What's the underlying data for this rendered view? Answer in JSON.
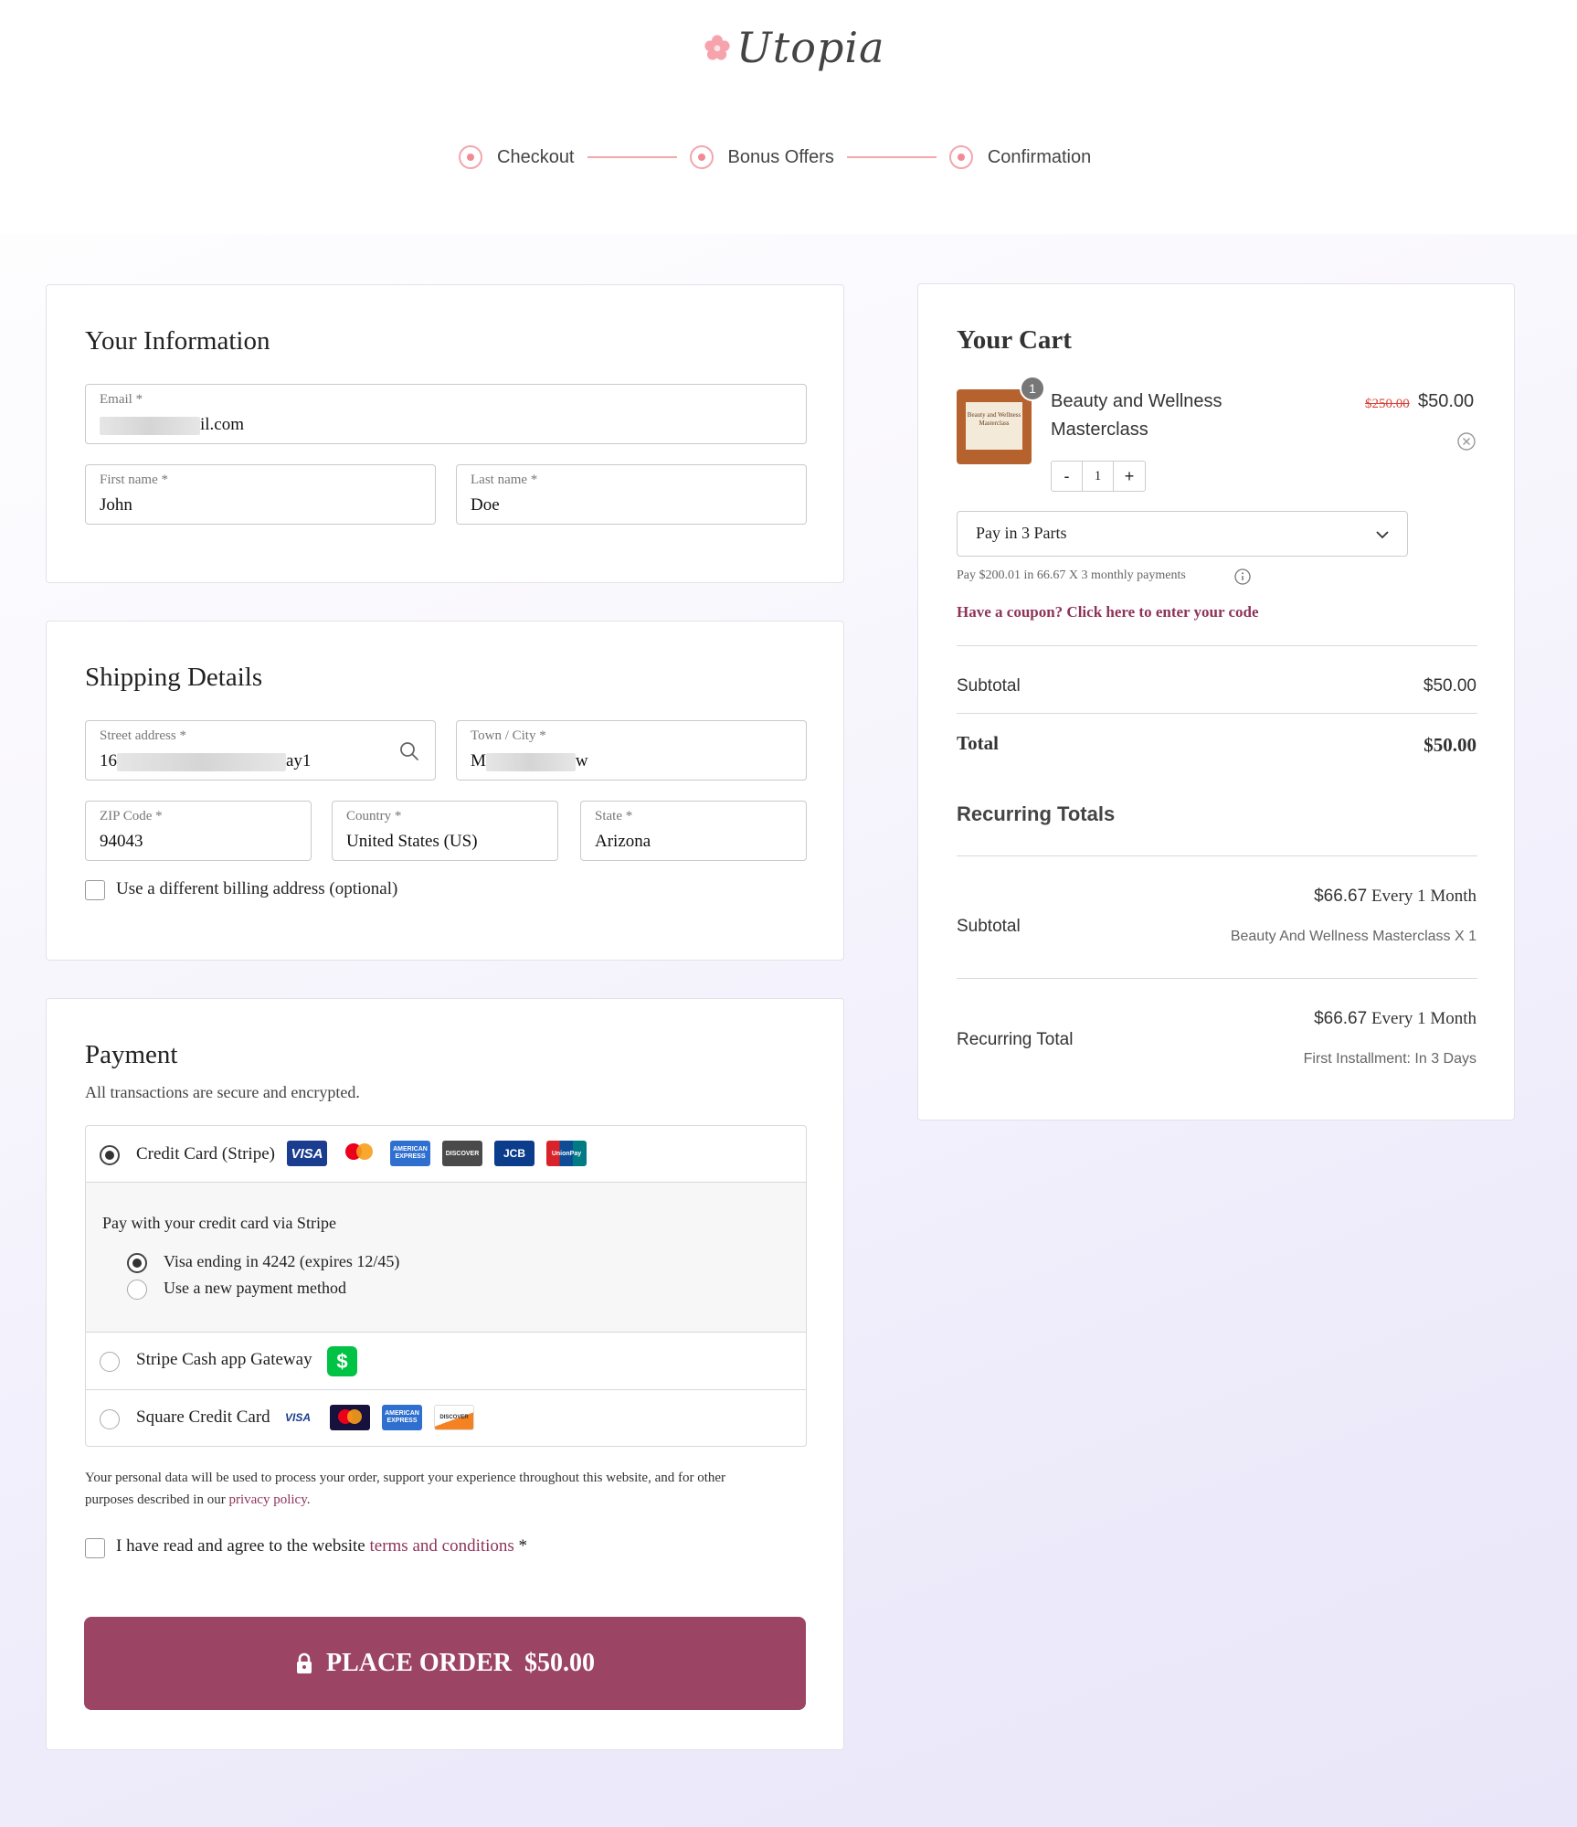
{
  "brand": {
    "name": "Utopia"
  },
  "steps": [
    {
      "label": "Checkout"
    },
    {
      "label": "Bonus Offers"
    },
    {
      "label": "Confirmation"
    }
  ],
  "info": {
    "title": "Your Information",
    "email_label": "Email *",
    "email_suffix": "il.com",
    "first_name_label": "First name *",
    "first_name": "John",
    "last_name_label": "Last name *",
    "last_name": "Doe"
  },
  "shipping": {
    "title": "Shipping Details",
    "street_label": "Street address *",
    "street_prefix": "16",
    "street_suffix": "ay1",
    "city_label": "Town / City *",
    "city_prefix": "M",
    "city_suffix": "w",
    "zip_label": "ZIP Code *",
    "zip": "94043",
    "country_label": "Country *",
    "country": "United States (US)",
    "state_label": "State *",
    "state": "Arizona",
    "billing_checkbox_label": "Use a different billing address (optional)"
  },
  "payment": {
    "title": "Payment",
    "subtitle": "All transactions are secure and encrypted.",
    "methods": [
      {
        "label": "Credit Card (Stripe)"
      },
      {
        "label": "Stripe Cash app Gateway"
      },
      {
        "label": "Square Credit Card"
      }
    ],
    "card_logos": [
      "VISA",
      "mastercard",
      "AMERICAN EXPRESS",
      "DISCOVER",
      "JCB",
      "UnionPay"
    ],
    "square_logos": [
      "VISA",
      "mastercard",
      "AMERICAN EXPRESS",
      "DISCOVER"
    ],
    "stripe_intro": "Pay with your credit card via Stripe",
    "saved_card": "Visa ending in 4242 (expires 12/45)",
    "new_method": "Use a new payment method",
    "privacy_text": "Your personal data will be used to process your order, support your experience throughout this website, and for other",
    "privacy_text2": "purposes described in our",
    "privacy_link": "privacy policy",
    "privacy_end": ".",
    "terms_prefix": "I have read and agree to the website",
    "terms_link": "terms and conditions",
    "terms_suffix": "*",
    "place_order_label": "PLACE ORDER",
    "place_order_amount": "$50.00"
  },
  "cart": {
    "title": "Your Cart",
    "item": {
      "badge": "1",
      "thumb_text": "Beauty and Wellness Masterclass",
      "name_line1": "Beauty and Wellness",
      "name_line2": "Masterclass",
      "old_price": "$250.00",
      "price": "$50.00",
      "qty": "1",
      "minus": "-",
      "plus": "+"
    },
    "plan_select": "Pay in 3 Parts",
    "plan_note": "Pay $200.01 in 66.67 X 3 monthly payments",
    "coupon": "Have a coupon? Click here to enter your code",
    "subtotal_label": "Subtotal",
    "subtotal": "$50.00",
    "total_label": "Total",
    "total": "$50.00",
    "recurring_title": "Recurring Totals",
    "rec_subtotal_label": "Subtotal",
    "rec_subtotal_amount": "$66.67",
    "rec_subtotal_period": "Every 1 Month",
    "rec_subtotal_note": "Beauty And Wellness Masterclass X 1",
    "rec_total_label": "Recurring Total",
    "rec_total_amount": "$66.67",
    "rec_total_period": "Every 1 Month",
    "rec_total_note": "First Installment: In 3 Days"
  },
  "colors": {
    "accent": "#9c4463",
    "step": "#f08b95",
    "link": "#8e3459"
  },
  "icons": [
    "flower-logo-icon",
    "search-icon",
    "chevron-down-icon",
    "info-icon",
    "remove-circle-icon",
    "lock-icon",
    "cash-app-icon"
  ]
}
